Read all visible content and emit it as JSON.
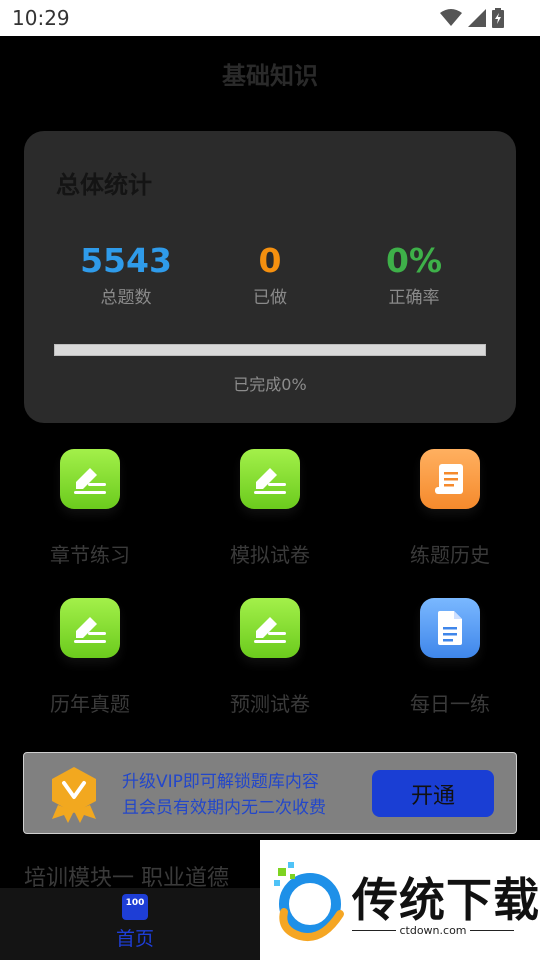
{
  "status_bar": {
    "time": "10:29"
  },
  "page": {
    "title": "基础知识"
  },
  "stats": {
    "title": "总体统计",
    "total": {
      "value": "5543",
      "label": "总题数",
      "color": "#2f9bea"
    },
    "done": {
      "value": "0",
      "label": "已做",
      "color": "#f5900f"
    },
    "accuracy": {
      "value": "0%",
      "label": "正确率",
      "color": "#3eb049"
    },
    "progress_text": "已完成0%",
    "progress_fraction": 0
  },
  "grid": {
    "items": [
      {
        "label": "章节练习",
        "icon": "pencil-edit-icon",
        "color": "green"
      },
      {
        "label": "模拟试卷",
        "icon": "pencil-edit-icon",
        "color": "green"
      },
      {
        "label": "练题历史",
        "icon": "scroll-history-icon",
        "color": "orange"
      },
      {
        "label": "历年真题",
        "icon": "pencil-edit-icon",
        "color": "green"
      },
      {
        "label": "预测试卷",
        "icon": "pencil-edit-icon",
        "color": "green"
      },
      {
        "label": "每日一练",
        "icon": "document-icon",
        "color": "blue"
      }
    ]
  },
  "vip": {
    "line1": "升级VIP即可解锁题库内容",
    "line2": "且会员有效期内无二次收费",
    "button": "开通"
  },
  "module": {
    "title": "培训模块一 职业道德"
  },
  "nav": {
    "home_label": "首页",
    "home_icon_text": "100"
  },
  "watermark": {
    "brand": "传统下载",
    "url": "ctdown.com"
  }
}
